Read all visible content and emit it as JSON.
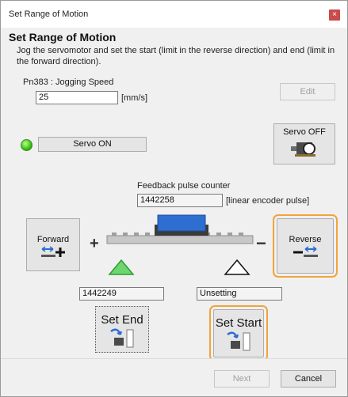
{
  "window": {
    "title": "Set Range of Motion",
    "close_glyph": "×"
  },
  "heading": "Set Range of Motion",
  "description": "Jog the servomotor and set the start (limit in the reverse direction) and end (limit in the forward direction).",
  "param": {
    "label": "Pn383 : Jogging Speed",
    "value": "25",
    "unit": "[mm/s]",
    "edit_label": "Edit"
  },
  "servo": {
    "on_label": "Servo ON",
    "off_label": "Servo OFF"
  },
  "feedback": {
    "label": "Feedback pulse counter",
    "value": "1442258",
    "unit": "[linear encoder pulse]"
  },
  "jog": {
    "forward_label": "Forward",
    "reverse_label": "Reverse",
    "plus": "+",
    "minus": "−"
  },
  "end": {
    "value": "1442249",
    "button_label": "Set End"
  },
  "start": {
    "value": "Unsetting",
    "button_label": "Set Start"
  },
  "footer": {
    "next_label": "Next",
    "cancel_label": "Cancel"
  },
  "colors": {
    "accent_highlight": "#f2a33a",
    "led_on": "#27b400",
    "slider_block": "#2f6ed1"
  }
}
